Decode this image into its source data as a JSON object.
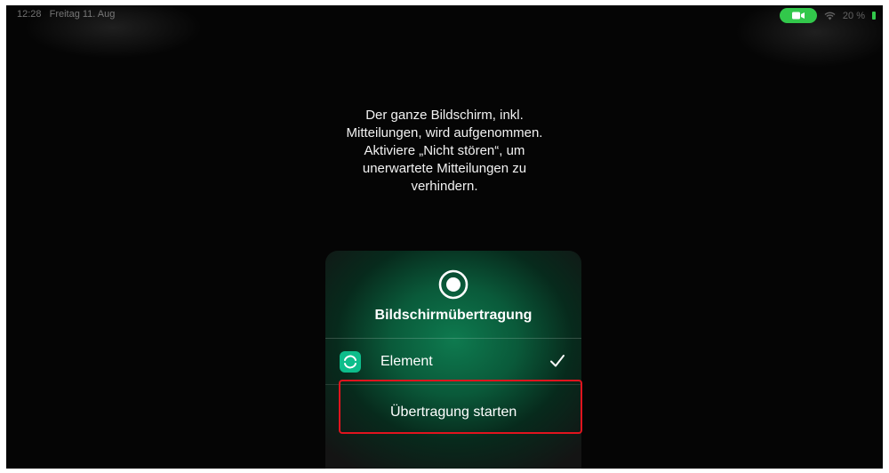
{
  "status_bar": {
    "time": "12:28",
    "date": "Freitag 11. Aug",
    "battery": "20 %",
    "colors": {
      "recording_pill": "#32c84b"
    }
  },
  "message": {
    "lines": [
      "Der ganze Bildschirm, inkl.",
      "Mitteilungen, wird aufgenommen.",
      "Aktiviere „Nicht stören“, um",
      "unerwartete Mitteilungen zu",
      "verhindern."
    ]
  },
  "broadcast_panel": {
    "title": "Bildschirmübertragung",
    "app": {
      "name": "Element",
      "icon": "element-app-icon",
      "selected": true
    },
    "start_label": "Übertragung starten",
    "colors": {
      "glow": "#0e7a4f",
      "app_icon": "#0dbd8b",
      "highlight": "#e0141e"
    }
  }
}
